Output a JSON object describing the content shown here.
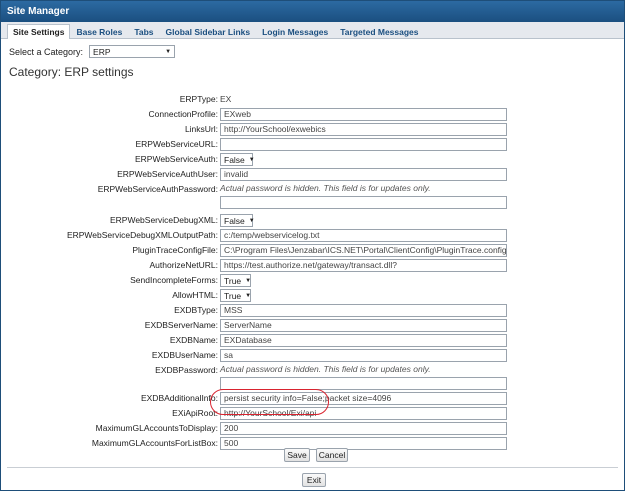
{
  "window": {
    "title": "Site Manager"
  },
  "tabs": [
    "Site Settings",
    "Base Roles",
    "Tabs",
    "Global Sidebar Links",
    "Login Messages",
    "Targeted Messages"
  ],
  "category": {
    "label": "Select a Category:",
    "value": "ERP"
  },
  "page_title": "Category: ERP settings",
  "fields": {
    "erptype": {
      "label": "ERPType:",
      "value": "EX"
    },
    "connectionprofile": {
      "label": "ConnectionProfile:",
      "value": "EXweb"
    },
    "linksurl": {
      "label": "LinksUrl:",
      "value": "http://YourSchool/exwebics"
    },
    "erpwebserviceurl": {
      "label": "ERPWebServiceURL:",
      "value": ""
    },
    "erpwebserviceauth": {
      "label": "ERPWebServiceAuth:",
      "value": "False"
    },
    "erpwebserviceauthuser": {
      "label": "ERPWebServiceAuthUser:",
      "value": "invalid"
    },
    "erpwebserviceauthpassword": {
      "label": "ERPWebServiceAuthPassword:",
      "hint": "Actual password is hidden. This field is for updates only.",
      "value": ""
    },
    "erpwebservicedebugxml": {
      "label": "ERPWebServiceDebugXML:",
      "value": "False"
    },
    "erpwebservicedebugxmloutputpath": {
      "label": "ERPWebServiceDebugXMLOutputPath:",
      "value": "c:/temp/webservicelog.txt"
    },
    "plugintraceconfigfile": {
      "label": "PluginTraceConfigFile:",
      "value": "C:\\Program Files\\Jenzabar\\ICS.NET\\Portal\\ClientConfig\\PluginTrace.config"
    },
    "authorizeneturl": {
      "label": "AuthorizeNetURL:",
      "value": "https://test.authorize.net/gateway/transact.dll?"
    },
    "sendincompleteforms": {
      "label": "SendIncompleteForms:",
      "value": "True"
    },
    "allowhtml": {
      "label": "AllowHTML:",
      "value": "True"
    },
    "exdbtype": {
      "label": "EXDBType:",
      "value": "MSS"
    },
    "exdbservername": {
      "label": "EXDBServerName:",
      "value": "ServerName"
    },
    "exdbname": {
      "label": "EXDBName:",
      "value": "EXDatabase"
    },
    "exdbusername": {
      "label": "EXDBUserName:",
      "value": "sa"
    },
    "exdbpassword": {
      "label": "EXDBPassword:",
      "hint": "Actual password is hidden. This field is for updates only.",
      "value": ""
    },
    "exdbadditionalinfo": {
      "label": "EXDBAdditionalInfo:",
      "value": "persist security info=False;packet size=4096"
    },
    "exiapiroot": {
      "label": "EXiApiRoot:",
      "value": "http://YourSchool/Exi/api"
    },
    "maximumglaccountstodisplay": {
      "label": "MaximumGLAccountsToDisplay:",
      "value": "200"
    },
    "maximumglaccountsforlistbox": {
      "label": "MaximumGLAccountsForListBox:",
      "value": "500"
    }
  },
  "buttons": {
    "save": "Save",
    "cancel": "Cancel",
    "exit": "Exit"
  },
  "colors": {
    "titlebar": "#1b4f80",
    "highlight": "#d9232f"
  }
}
